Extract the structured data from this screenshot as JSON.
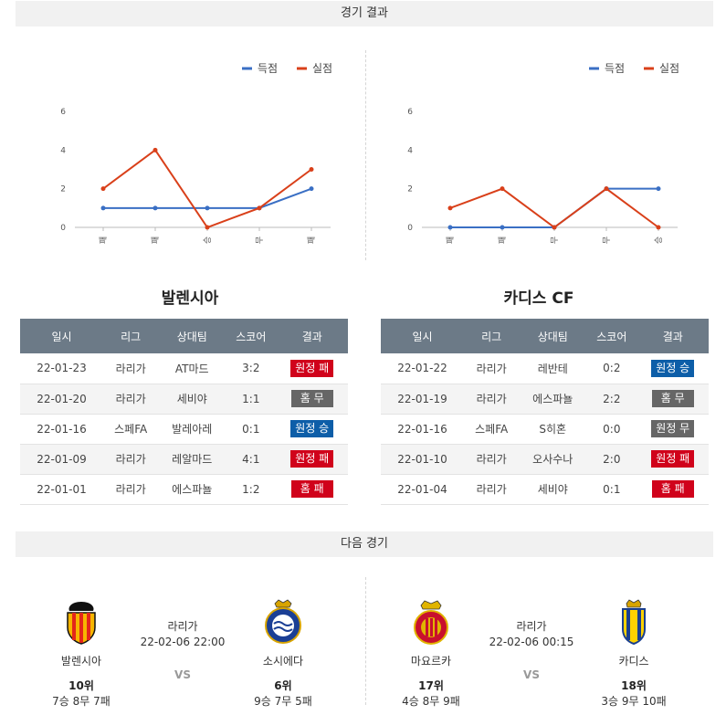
{
  "headers": {
    "results": "경기 결과",
    "next": "다음 경기"
  },
  "colors": {
    "scored": "#3a6fc4",
    "conceded": "#d9401a",
    "loss": "#d0021b",
    "win": "#0d5ea8",
    "draw": "#666666",
    "table_header": "#6c7a87"
  },
  "legend": {
    "scored": "득점",
    "conceded": "실점"
  },
  "chart_data": [
    {
      "type": "line",
      "categories": [
        "패",
        "패",
        "승",
        "무",
        "패"
      ],
      "series": [
        {
          "name": "득점",
          "values": [
            1,
            1,
            1,
            1,
            2
          ]
        },
        {
          "name": "실점",
          "values": [
            2,
            4,
            0,
            1,
            3
          ]
        }
      ],
      "yticks": [
        "0",
        "2",
        "4",
        "6"
      ],
      "ylim": [
        0,
        6
      ],
      "legend_position": "top-right",
      "grid": false
    },
    {
      "type": "line",
      "categories": [
        "패",
        "패",
        "무",
        "무",
        "승"
      ],
      "series": [
        {
          "name": "득점",
          "values": [
            0,
            0,
            0,
            2,
            2
          ]
        },
        {
          "name": "실점",
          "values": [
            1,
            2,
            0,
            2,
            0
          ]
        }
      ],
      "yticks": [
        "0",
        "2",
        "4",
        "6"
      ],
      "ylim": [
        0,
        6
      ],
      "legend_position": "top-right",
      "grid": false
    }
  ],
  "teams": [
    {
      "name": "발렌시아",
      "table_headers": [
        "일시",
        "리그",
        "상대팀",
        "스코어",
        "결과"
      ],
      "rows": [
        {
          "date": "22-01-23",
          "league": "라리가",
          "opponent": "AT마드",
          "score": "3:2",
          "result": "원정 패",
          "kind": "loss"
        },
        {
          "date": "22-01-20",
          "league": "라리가",
          "opponent": "세비야",
          "score": "1:1",
          "result": "홈 무",
          "kind": "draw"
        },
        {
          "date": "22-01-16",
          "league": "스페FA",
          "opponent": "발레아레",
          "score": "0:1",
          "result": "원정 승",
          "kind": "win"
        },
        {
          "date": "22-01-09",
          "league": "라리가",
          "opponent": "레알마드",
          "score": "4:1",
          "result": "원정 패",
          "kind": "loss"
        },
        {
          "date": "22-01-01",
          "league": "라리가",
          "opponent": "에스파뇰",
          "score": "1:2",
          "result": "홈 패",
          "kind": "loss"
        }
      ]
    },
    {
      "name": "카디스 CF",
      "table_headers": [
        "일시",
        "리그",
        "상대팀",
        "스코어",
        "결과"
      ],
      "rows": [
        {
          "date": "22-01-22",
          "league": "라리가",
          "opponent": "레반테",
          "score": "0:2",
          "result": "원정 승",
          "kind": "win"
        },
        {
          "date": "22-01-19",
          "league": "라리가",
          "opponent": "에스파뇰",
          "score": "2:2",
          "result": "홈 무",
          "kind": "draw"
        },
        {
          "date": "22-01-16",
          "league": "스페FA",
          "opponent": "S히혼",
          "score": "0:0",
          "result": "원정 무",
          "kind": "draw"
        },
        {
          "date": "22-01-10",
          "league": "라리가",
          "opponent": "오사수나",
          "score": "2:0",
          "result": "원정 패",
          "kind": "loss"
        },
        {
          "date": "22-01-04",
          "league": "라리가",
          "opponent": "세비야",
          "score": "0:1",
          "result": "홈 패",
          "kind": "loss"
        }
      ]
    }
  ],
  "next_matches": [
    {
      "home": {
        "name": "발렌시아",
        "rank": "10위",
        "record": "7승 8무 7패",
        "crest": "valencia-crest-icon"
      },
      "league": "라리가",
      "datetime": "22-02-06 22:00",
      "vs": "VS",
      "away": {
        "name": "소시에다",
        "rank": "6위",
        "record": "9승 7무 5패",
        "crest": "real-sociedad-crest-icon"
      }
    },
    {
      "home": {
        "name": "마요르카",
        "rank": "17위",
        "record": "4승 8무 9패",
        "crest": "mallorca-crest-icon"
      },
      "league": "라리가",
      "datetime": "22-02-06 00:15",
      "vs": "VS",
      "away": {
        "name": "카디스",
        "rank": "18위",
        "record": "3승 9무 10패",
        "crest": "cadiz-crest-icon"
      }
    }
  ]
}
